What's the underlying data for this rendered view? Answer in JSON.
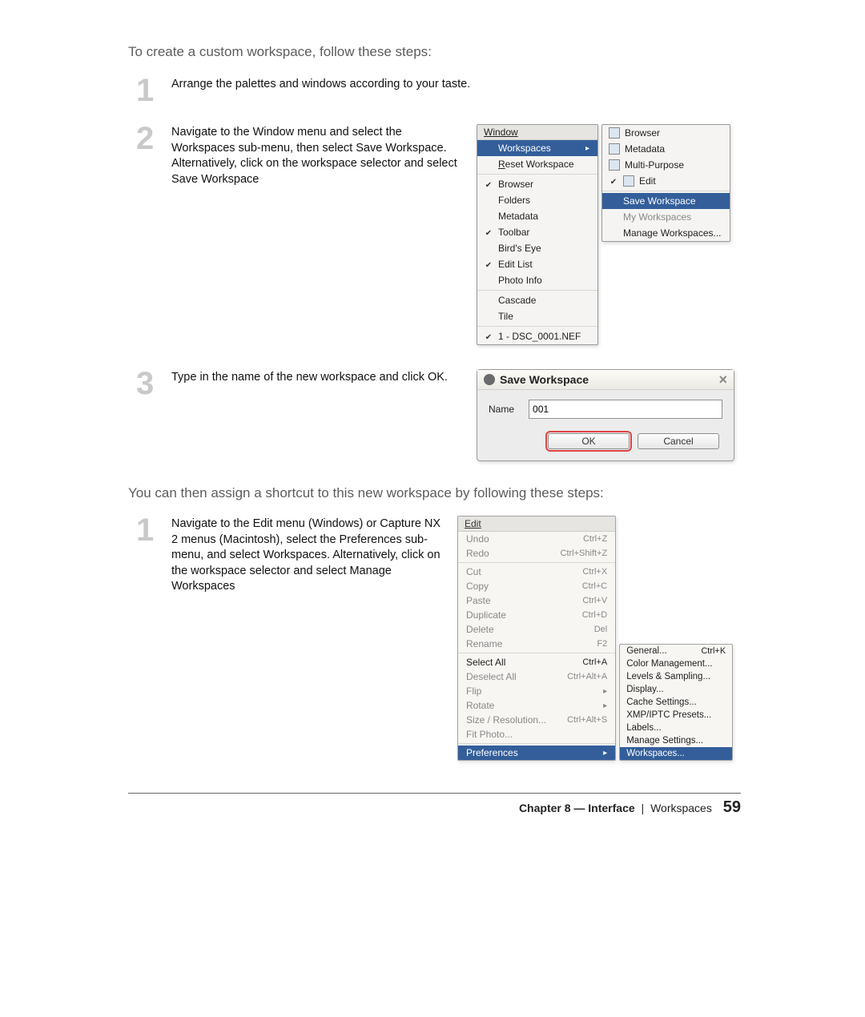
{
  "intro": "To create a custom workspace, follow these steps:",
  "intro2": "You can then assign a shortcut to this new workspace by following these steps:",
  "stepsA": {
    "s1": {
      "num": "1",
      "text": "Arrange the palettes and windows according to your taste."
    },
    "s2": {
      "num": "2",
      "text": "Navigate to the Window menu and select the Workspaces sub-menu, then select Save Workspace. Alternatively, click on the workspace selector and select Save Workspace"
    },
    "s3": {
      "num": "3",
      "text": "Type in the name of the new workspace and click OK."
    }
  },
  "stepsB": {
    "s1": {
      "num": "1",
      "text": "Navigate to the Edit menu (Windows) or Capture NX 2 menus (Macintosh), select the Preferences sub-menu, and select Workspaces. Alternatively, click on the workspace selector and select Manage Workspaces"
    }
  },
  "window_menu": {
    "title": "Window",
    "items": {
      "workspaces": "Workspaces",
      "reset": "Reset Workspace",
      "browser": "Browser",
      "folders": "Folders",
      "metadata": "Metadata",
      "toolbar": "Toolbar",
      "birds": "Bird's Eye",
      "editlist": "Edit List",
      "photoinfo": "Photo Info",
      "cascade": "Cascade",
      "tile": "Tile",
      "openfile": "1 - DSC_0001.NEF"
    }
  },
  "workspace_sub": {
    "browser": "Browser",
    "metadata": "Metadata",
    "multi": "Multi-Purpose",
    "edit": "Edit",
    "save": "Save Workspace",
    "my": "My Workspaces",
    "manage": "Manage Workspaces..."
  },
  "save_dialog": {
    "title": "Save Workspace",
    "name_label": "Name",
    "name_value": "001",
    "ok": "OK",
    "cancel": "Cancel"
  },
  "edit_menu": {
    "title": "Edit",
    "undo": {
      "label": "Undo",
      "sc": "Ctrl+Z"
    },
    "redo": {
      "label": "Redo",
      "sc": "Ctrl+Shift+Z"
    },
    "cut": {
      "label": "Cut",
      "sc": "Ctrl+X"
    },
    "copy": {
      "label": "Copy",
      "sc": "Ctrl+C"
    },
    "paste": {
      "label": "Paste",
      "sc": "Ctrl+V"
    },
    "duplicate": {
      "label": "Duplicate",
      "sc": "Ctrl+D"
    },
    "delete": {
      "label": "Delete",
      "sc": "Del"
    },
    "rename": {
      "label": "Rename",
      "sc": "F2"
    },
    "selectall": {
      "label": "Select All",
      "sc": "Ctrl+A"
    },
    "deselectall": {
      "label": "Deselect All",
      "sc": "Ctrl+Alt+A"
    },
    "flip": {
      "label": "Flip",
      "sc": ""
    },
    "rotate": {
      "label": "Rotate",
      "sc": ""
    },
    "sizeres": {
      "label": "Size / Resolution...",
      "sc": "Ctrl+Alt+S"
    },
    "fitphoto": {
      "label": "Fit Photo...",
      "sc": ""
    },
    "preferences": {
      "label": "Preferences",
      "sc": ""
    }
  },
  "pref_sub": {
    "general": {
      "label": "General...",
      "sc": "Ctrl+K"
    },
    "color": {
      "label": "Color Management..."
    },
    "levels": {
      "label": "Levels & Sampling..."
    },
    "display": {
      "label": "Display..."
    },
    "cache": {
      "label": "Cache Settings..."
    },
    "xmp": {
      "label": "XMP/IPTC Presets..."
    },
    "labels": {
      "label": "Labels..."
    },
    "manage": {
      "label": "Manage Settings..."
    },
    "workspaces": {
      "label": "Workspaces..."
    }
  },
  "footer": {
    "chapter": "Chapter 8 — Interface",
    "section": "Workspaces",
    "page": "59"
  }
}
